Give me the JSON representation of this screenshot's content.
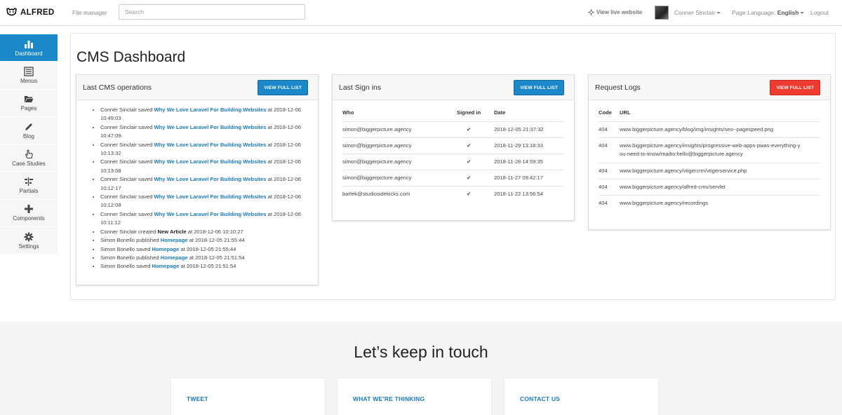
{
  "topbar": {
    "logo_text": "ALFRED",
    "file_manager": "File manager",
    "search_placeholder": "Search",
    "view_live": "View live website",
    "user_name": "Conner Sinclair",
    "page_language_label": "Page Language:",
    "page_language_value": "English",
    "logout": "Logout"
  },
  "sidebar": {
    "items": [
      {
        "label": "Dashboard",
        "icon": "bar-chart-icon",
        "active": true
      },
      {
        "label": "Menus",
        "icon": "list-icon"
      },
      {
        "label": "Pages",
        "icon": "folder-open-icon"
      },
      {
        "label": "Blog",
        "icon": "pencil-icon"
      },
      {
        "label": "Case Studies",
        "icon": "hand-pointer-icon"
      },
      {
        "label": "Partials",
        "icon": "align-icon"
      },
      {
        "label": "Components",
        "icon": "plus-icon"
      },
      {
        "label": "Settings",
        "icon": "gear-icon"
      }
    ]
  },
  "main": {
    "title": "CMS Dashboard"
  },
  "cms_ops": {
    "title": "Last CMS operations",
    "button": "VIEW FULL LIST",
    "items": [
      {
        "who": "Conner Sinclair",
        "action": "saved",
        "target": "Why We Love Laravel For Building Websites",
        "at": "at",
        "date": "2018-12-06 10:49:03"
      },
      {
        "who": "Conner Sinclair",
        "action": "saved",
        "target": "Why We Love Laravel For Building Websites",
        "at": "at",
        "date": "2018-12-06 10:47:09"
      },
      {
        "who": "Conner Sinclair",
        "action": "saved",
        "target": "Why We Love Laravel For Building Websites",
        "at": "at",
        "date": "2018-12-06 10:13:32"
      },
      {
        "who": "Conner Sinclair",
        "action": "saved",
        "target": "Why We Love Laravel For Building Websites",
        "at": "at",
        "date": "2018-12-06 10:13:08"
      },
      {
        "who": "Conner Sinclair",
        "action": "saved",
        "target": "Why We Love Laravel For Building Websites",
        "at": "at",
        "date": "2018-12-06 10:12:17"
      },
      {
        "who": "Conner Sinclair",
        "action": "saved",
        "target": "Why We Love Laravel For Building Websites",
        "at": "at",
        "date": "2018-12-06 10:12:08"
      },
      {
        "who": "Conner Sinclair",
        "action": "saved",
        "target": "Why We Love Laravel For Building Websites",
        "at": "at",
        "date": "2018-12-06 10:11:12"
      },
      {
        "who": "Conner Sinclair",
        "action": "created",
        "target": "New Article",
        "at": "at",
        "date": "2018-12-06 10:10:27",
        "plain": true
      },
      {
        "who": "Simon Bonello",
        "action": "published",
        "target": "Homepage",
        "at": "at",
        "date": "2018-12-05 21:55:44"
      },
      {
        "who": "Simon Bonello",
        "action": "saved",
        "target": "Homepage",
        "at": "at",
        "date": "2018-12-05 21:55:44"
      },
      {
        "who": "Simon Bonello",
        "action": "published",
        "target": "Homepage",
        "at": "at",
        "date": "2018-12-05 21:51:54"
      },
      {
        "who": "Simon Bonello",
        "action": "saved",
        "target": "Homepage",
        "at": "at",
        "date": "2018-12-05 21:51:54"
      }
    ]
  },
  "signins": {
    "title": "Last Sign ins",
    "button": "VIEW FULL LIST",
    "columns": [
      "Who",
      "Signed in",
      "Date"
    ],
    "rows": [
      {
        "who": "simon@biggerpicture.agency",
        "signed_in": "✔",
        "date": "2018-12-05 21:37:32"
      },
      {
        "who": "simon@biggerpicture.agency",
        "signed_in": "✔",
        "date": "2018-11-29 13:18:33"
      },
      {
        "who": "simon@biggerpicture.agency",
        "signed_in": "✔",
        "date": "2018-11-28 14:59:35"
      },
      {
        "who": "simon@biggerpicture.agency",
        "signed_in": "✔",
        "date": "2018-11-27 09:42:17"
      },
      {
        "who": "bartek@studiosidekicks.com",
        "signed_in": "✔",
        "date": "2018-11-22 13:56:54"
      }
    ]
  },
  "logs": {
    "title": "Request Logs",
    "button": "VIEW FULL LIST",
    "columns": [
      "Code",
      "URL"
    ],
    "rows": [
      {
        "code": "404",
        "url": "www.biggerpicture.agency/blog/img/insights/seo--pagespeed.png"
      },
      {
        "code": "404",
        "url": "www.biggerpicture.agency/insights/progressive-web-apps-pwas-everything-y\nou-need-to-know/mailto:hello@biggerpicture.agency"
      },
      {
        "code": "404",
        "url": "www.biggerpicture.agency/vtigercrm/vtigerservice.php"
      },
      {
        "code": "404",
        "url": "www.biggerpicture.agency/alfred-cms/servlet"
      },
      {
        "code": "404",
        "url": "www.biggerpicture.agency/recordings"
      }
    ]
  },
  "footer": {
    "title": "Let’s keep in touch",
    "cards": [
      "TWEET",
      "WHAT WE’RE THINKING",
      "CONTACT US"
    ]
  },
  "colors": {
    "accent": "#1a88c9",
    "danger": "#ef3b2d",
    "link": "#1a79b8"
  }
}
